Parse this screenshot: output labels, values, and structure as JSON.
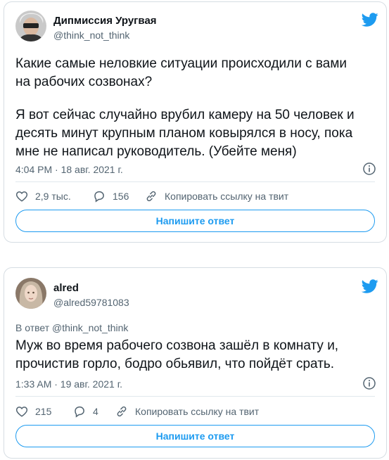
{
  "tweet1": {
    "author_name": "Дипмиссия Уругвая",
    "author_handle": "@think_not_think",
    "text_line1": "Какие самые неловкие ситуации происходили с вами",
    "text_line2": "на рабочих созвонах?",
    "text_line3": "Я вот сейчас случайно врубил камеру на 50 человек и",
    "text_line4": "десять минут крупным планом ковырялся в носу, пока",
    "text_line5": "мне не написал руководитель. (Убейте меня)",
    "timestamp": "4:04 PM · 18 авг. 2021 г.",
    "likes": "2,9 тыс.",
    "replies": "156",
    "copy_link": "Копировать ссылку на твит",
    "reply_button": "Напишите ответ"
  },
  "tweet2": {
    "author_name": "alred",
    "author_handle": "@alred59781083",
    "replying_to": "В ответ @think_not_think",
    "text_line1": "Муж во время рабочего созвона зашёл в комнату и,",
    "text_line2": "прочистив горло, бодро обьявил, что пойдёт срать.",
    "timestamp": "1:33 AM · 19 авг. 2021 г.",
    "likes": "215",
    "replies": "4",
    "copy_link": "Копировать ссылку на твит",
    "reply_button": "Напишите ответ"
  },
  "icons": {
    "brand": "twitter-bird-icon",
    "like": "heart-icon",
    "reply": "speech-bubble-icon",
    "link": "link-icon",
    "info": "info-icon"
  },
  "colors": {
    "accent": "#1d9bf0",
    "text": "#0f1419",
    "muted": "#536471",
    "border": "#d6dde3"
  }
}
